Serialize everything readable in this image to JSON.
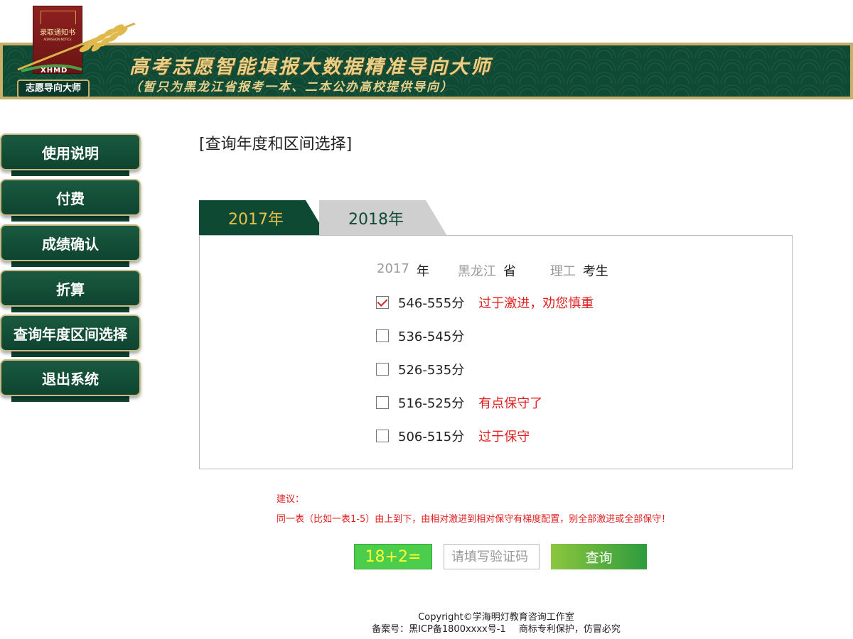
{
  "header": {
    "title": "高考志愿智能填报大数据精准导向大师",
    "subtitle": "（暂只为黑龙江省报考一本、二本公办高校提供导向）",
    "book_title": "录取通知书",
    "book_sub": "ADMISSION NOTICE",
    "logo_text": "XHMD",
    "brand_name": "志愿导向大师"
  },
  "sidebar": {
    "items": [
      {
        "label": "使用说明"
      },
      {
        "label": "付费"
      },
      {
        "label": "成绩确认"
      },
      {
        "label": "折算"
      },
      {
        "label": "查询年度区间选择"
      },
      {
        "label": "退出系统"
      }
    ]
  },
  "main": {
    "title": "[查询年度和区间选择]",
    "tabs": [
      {
        "label": "2017年",
        "active": true
      },
      {
        "label": "2018年",
        "active": false
      }
    ],
    "info": {
      "year": "2017",
      "year_unit": "年",
      "province": "黑龙江",
      "province_unit": "省",
      "category": "理工",
      "category_unit": "考生"
    },
    "options": [
      {
        "label": "546-555分",
        "note": "过于激进，劝您慎重",
        "checked": true
      },
      {
        "label": "536-545分",
        "note": "",
        "checked": false
      },
      {
        "label": "526-535分",
        "note": "",
        "checked": false
      },
      {
        "label": "516-525分",
        "note": "有点保守了",
        "checked": false
      },
      {
        "label": "506-515分",
        "note": "过于保守",
        "checked": false
      }
    ],
    "advice_title": "建议：",
    "advice_text": "同一表（比如一表1-5）由上到下，由相对激进到相对保守有梯度配置，别全部激进或全部保守！",
    "captcha": "18+2=",
    "code_placeholder": "请填写验证码",
    "query_label": "查询"
  },
  "footer": {
    "copyright": "Copyright©学海明灯教育咨询工作室",
    "icp": "备案号：黑ICP备1800xxxx号-1",
    "trademark": "商标专利保护，仿冒必究"
  },
  "colors": {
    "primary_green": "#0e4a33",
    "gold": "#e8c04a",
    "warning_red": "#e02020",
    "button_gradient_start": "#8cc63f",
    "button_gradient_end": "#2e9b3e"
  }
}
